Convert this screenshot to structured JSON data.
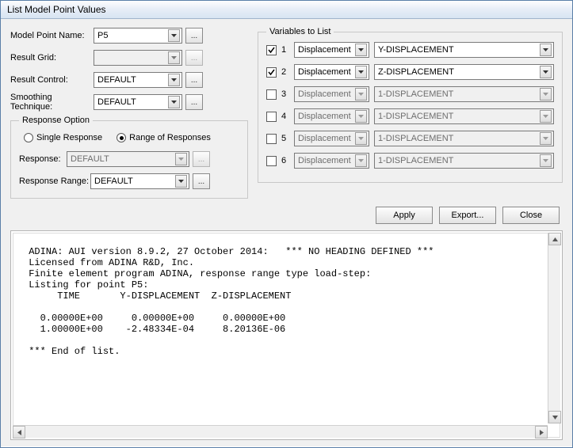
{
  "title": "List Model Point Values",
  "labels": {
    "model_point_name": "Model Point Name:",
    "result_grid": "Result Grid:",
    "result_control": "Result Control:",
    "smoothing": "Smoothing Technique:",
    "response_option": "Response Option",
    "single_response": "Single Response",
    "range_of_responses": "Range of Responses",
    "response": "Response:",
    "response_range": "Response Range:",
    "variables_to_list": "Variables to List"
  },
  "values": {
    "model_point_name": "P5",
    "result_grid": "",
    "result_control": "DEFAULT",
    "smoothing": "DEFAULT",
    "response": "DEFAULT",
    "response_range": "DEFAULT"
  },
  "response_mode": "range",
  "variables": [
    {
      "n": "1",
      "checked": true,
      "type": "Displacement",
      "name": "Y-DISPLACEMENT"
    },
    {
      "n": "2",
      "checked": true,
      "type": "Displacement",
      "name": "Z-DISPLACEMENT"
    },
    {
      "n": "3",
      "checked": false,
      "type": "Displacement",
      "name": "1-DISPLACEMENT"
    },
    {
      "n": "4",
      "checked": false,
      "type": "Displacement",
      "name": "1-DISPLACEMENT"
    },
    {
      "n": "5",
      "checked": false,
      "type": "Displacement",
      "name": "1-DISPLACEMENT"
    },
    {
      "n": "6",
      "checked": false,
      "type": "Displacement",
      "name": "1-DISPLACEMENT"
    }
  ],
  "buttons": {
    "apply": "Apply",
    "export": "Export...",
    "close": "Close",
    "dots": "..."
  },
  "output": " ADINA: AUI version 8.9.2, 27 October 2014:   *** NO HEADING DEFINED ***\n Licensed from ADINA R&D, Inc.\n Finite element program ADINA, response range type load-step:\n Listing for point P5:\n      TIME       Y-DISPLACEMENT  Z-DISPLACEMENT  \n\n   0.00000E+00     0.00000E+00     0.00000E+00\n   1.00000E+00    -2.48334E-04     8.20136E-06\n\n *** End of list."
}
